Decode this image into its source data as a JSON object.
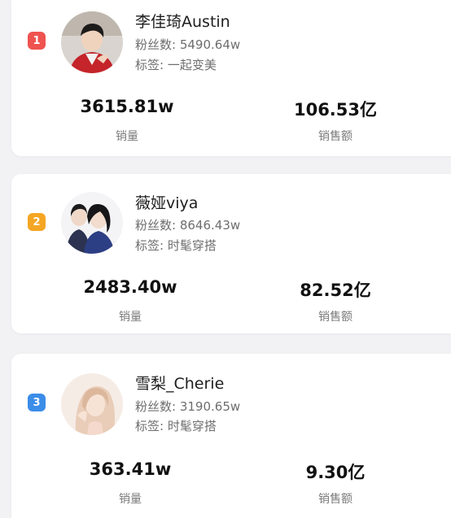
{
  "rankings": [
    {
      "rank": "1",
      "name": "李佳琦Austin",
      "fans_label": "粉丝数:",
      "fans": "5490.64w",
      "tag_label": "标签:",
      "tag": "一起变美",
      "sales": "3615.81w",
      "sales_label": "销量",
      "revenue": "106.53亿",
      "revenue_label": "销售额",
      "badge_color": "#ef5350"
    },
    {
      "rank": "2",
      "name": "薇娅viya",
      "fans_label": "粉丝数:",
      "fans": "8646.43w",
      "tag_label": "标签:",
      "tag": "时髦穿搭",
      "sales": "2483.40w",
      "sales_label": "销量",
      "revenue": "82.52亿",
      "revenue_label": "销售额",
      "badge_color": "#f5a623"
    },
    {
      "rank": "3",
      "name": "雪梨_Cherie",
      "fans_label": "粉丝数:",
      "fans": "3190.65w",
      "tag_label": "标签:",
      "tag": "时髦穿搭",
      "sales": "363.41w",
      "sales_label": "销量",
      "revenue": "9.30亿",
      "revenue_label": "销售额",
      "badge_color": "#3b8de8"
    }
  ]
}
